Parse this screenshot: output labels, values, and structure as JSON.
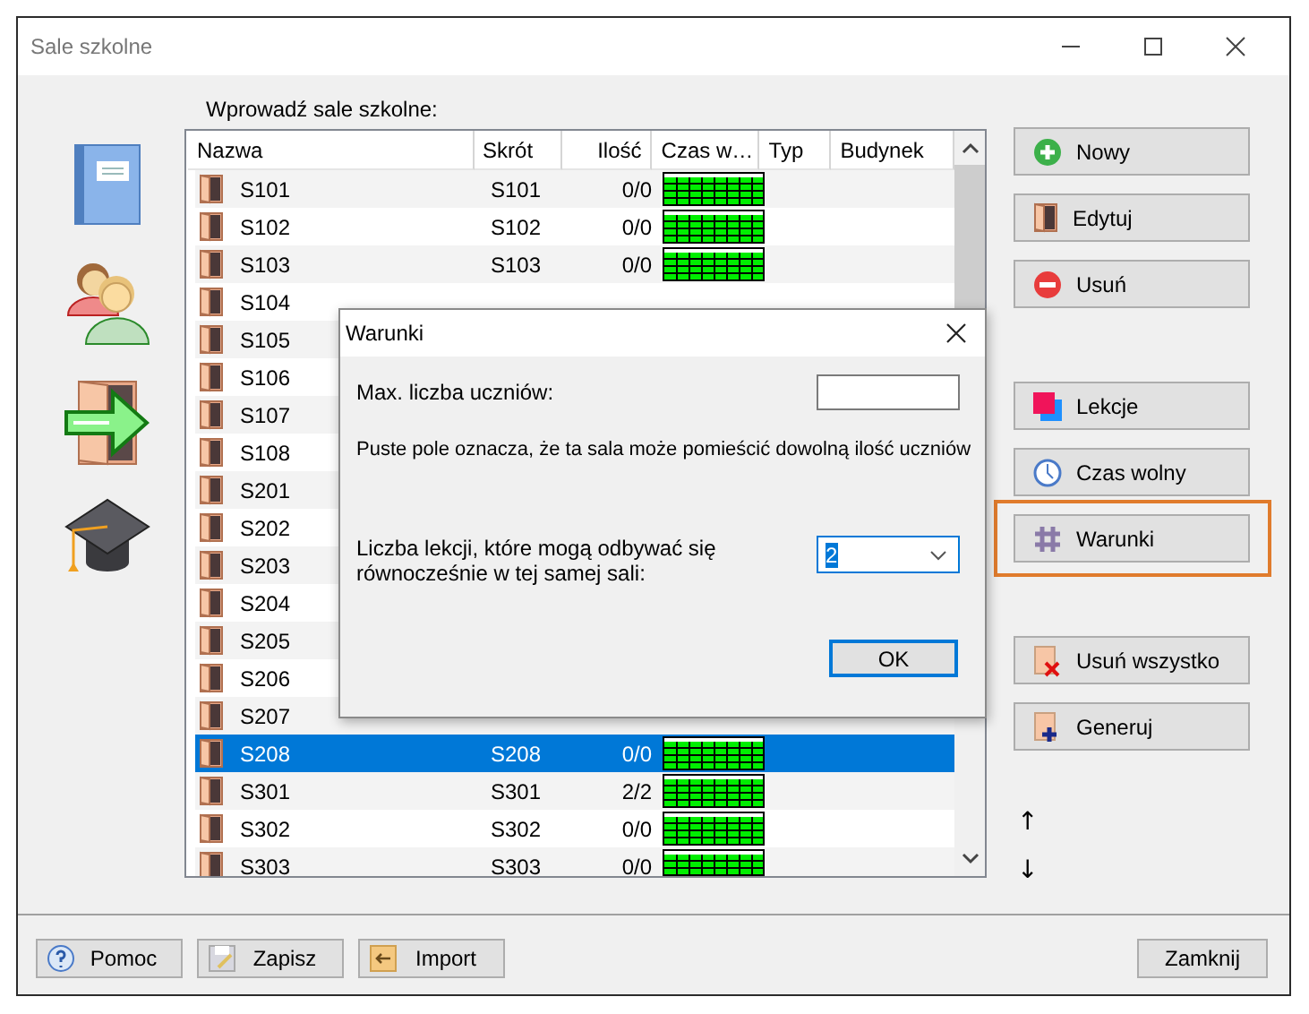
{
  "window": {
    "title": "Sale szkolne"
  },
  "list": {
    "label": "Wprowadź sale szkolne:",
    "columns": [
      "Nazwa",
      "Skrót",
      "Ilość",
      "Czas w…",
      "Typ",
      "Budynek"
    ],
    "rows": [
      {
        "name": "S101",
        "abbr": "S101",
        "count": "0/0",
        "selected": false
      },
      {
        "name": "S102",
        "abbr": "S102",
        "count": "0/0",
        "selected": false
      },
      {
        "name": "S103",
        "abbr": "S103",
        "count": "0/0",
        "selected": false
      },
      {
        "name": "S104",
        "selected": false
      },
      {
        "name": "S105",
        "selected": false
      },
      {
        "name": "S106",
        "selected": false
      },
      {
        "name": "S107",
        "selected": false
      },
      {
        "name": "S108",
        "selected": false
      },
      {
        "name": "S201",
        "selected": false
      },
      {
        "name": "S202",
        "selected": false
      },
      {
        "name": "S203",
        "selected": false
      },
      {
        "name": "S204",
        "selected": false
      },
      {
        "name": "S205",
        "selected": false
      },
      {
        "name": "S206",
        "selected": false
      },
      {
        "name": "S207",
        "selected": false
      },
      {
        "name": "S208",
        "abbr": "S208",
        "count": "0/0",
        "selected": true
      },
      {
        "name": "S301",
        "abbr": "S301",
        "count": "2/2",
        "selected": false
      },
      {
        "name": "S302",
        "abbr": "S302",
        "count": "0/0",
        "selected": false
      },
      {
        "name": "S303",
        "abbr": "S303",
        "count": "0/0",
        "selected": false
      }
    ]
  },
  "action_groups": [
    [
      {
        "label": "Nowy",
        "kind": "add",
        "highlighted": false
      },
      {
        "label": "Edytuj",
        "kind": "edit",
        "highlighted": false
      },
      {
        "label": "Usuń",
        "kind": "delete",
        "highlighted": false
      }
    ],
    [
      {
        "label": "Lekcje",
        "kind": "lessons",
        "highlighted": false
      },
      {
        "label": "Czas wolny",
        "kind": "time",
        "highlighted": false
      },
      {
        "label": "Warunki",
        "kind": "conditions",
        "highlighted": true
      }
    ],
    [
      {
        "label": "Usuń wszystko",
        "kind": "delete_all",
        "highlighted": false
      },
      {
        "label": "Generuj",
        "kind": "generate",
        "highlighted": false
      }
    ]
  ],
  "move_buttons": [
    "↑",
    "↓"
  ],
  "footer_buttons": [
    {
      "label": "Pomoc",
      "kind": "help"
    },
    {
      "label": "Zapisz",
      "kind": "save"
    },
    {
      "label": "Import",
      "kind": "import"
    }
  ],
  "close_button": "Zamknij",
  "dialog": {
    "title": "Warunki",
    "max_label": "Max. liczba uczniów:",
    "hint": "Puste pole oznacza, że ta sala może pomieścić dowolną ilość uczniów",
    "lessons_label": "Liczba lekcji, które mogą odbywać się równocześnie w tej samej sali:",
    "lessons_value": "2",
    "ok": "OK"
  }
}
